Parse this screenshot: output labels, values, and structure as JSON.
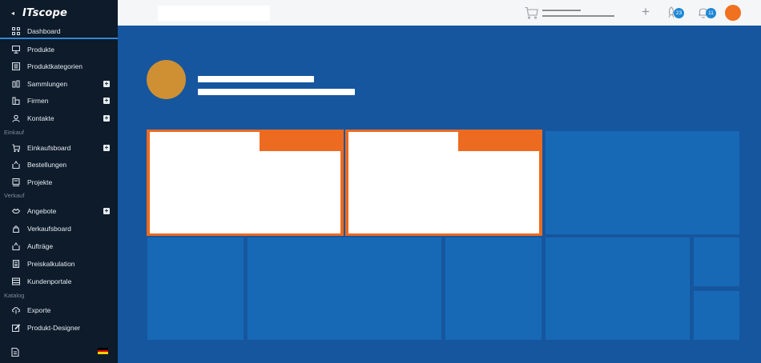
{
  "sidebar": {
    "collapse_glyph": "◂",
    "brand": "ITscope",
    "items": [
      {
        "label": "Dashboard",
        "icon": "dashboard-grid-icon",
        "active": true
      },
      {
        "label": "Produkte",
        "icon": "monitor-icon"
      },
      {
        "label": "Produktkategorien",
        "icon": "category-list-icon"
      },
      {
        "label": "Sammlungen",
        "icon": "collections-icon",
        "add": true
      },
      {
        "label": "Firmen",
        "icon": "building-icon",
        "add": true
      },
      {
        "label": "Kontakte",
        "icon": "contacts-icon",
        "add": true
      },
      {
        "label": "Einkaufsboard",
        "icon": "cart-icon",
        "add": true
      },
      {
        "label": "Bestellungen",
        "icon": "orders-icon"
      },
      {
        "label": "Projekte",
        "icon": "projects-icon"
      },
      {
        "label": "Angebote",
        "icon": "offers-icon",
        "add": true
      },
      {
        "label": "Verkaufsboard",
        "icon": "sales-bag-icon"
      },
      {
        "label": "Aufträge",
        "icon": "orders-box-icon"
      },
      {
        "label": "Preiskalkulation",
        "icon": "calculator-icon"
      },
      {
        "label": "Kundenportale",
        "icon": "portal-icon"
      },
      {
        "label": "Exporte",
        "icon": "cloud-export-icon"
      },
      {
        "label": "Produkt-Designer",
        "icon": "edit-designer-icon"
      }
    ],
    "sections": {
      "einkauf": "Einkauf",
      "verkauf": "Verkauf",
      "katalog": "Katalog"
    },
    "add_glyph": "+",
    "flag_colors": [
      "#000000",
      "#dd0000",
      "#ffce00"
    ]
  },
  "topbar": {
    "search_value": "",
    "add_glyph": "+",
    "rocket_badge": "23",
    "bell_badge": "11"
  },
  "colors": {
    "background": "#16569e",
    "sidebar": "#0d1b2a",
    "accent_orange": "#ec6b20",
    "tile_blue": "#1769b6",
    "profile_avatar": "#cf9033",
    "user_avatar": "#f0711f",
    "badge": "#1e88d6"
  }
}
